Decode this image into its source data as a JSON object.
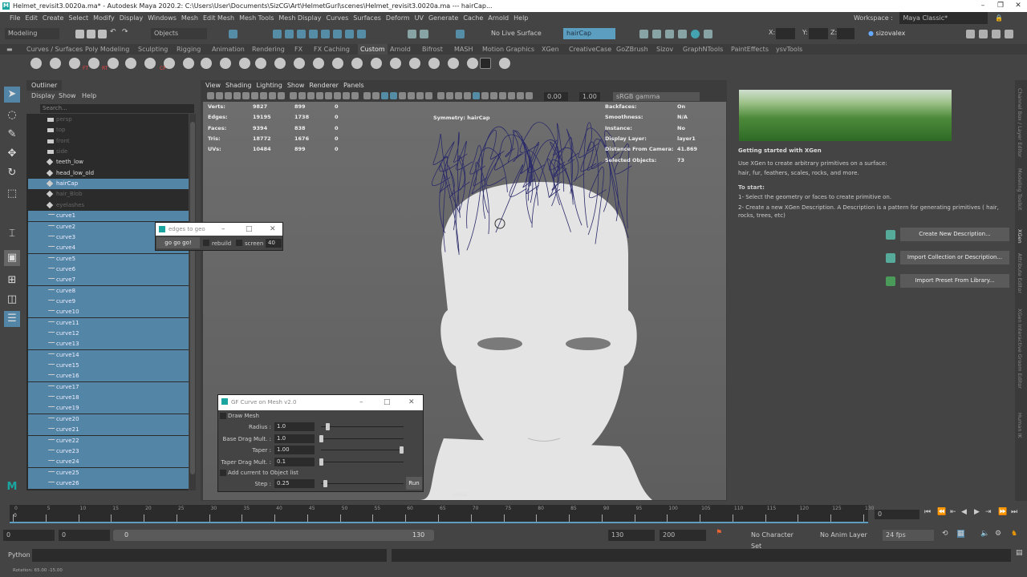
{
  "window": {
    "title": "Helmet_revisit3.0020a.ma* - Autodesk Maya 2020.2: C:\\Users\\User\\Documents\\SizCG\\Art\\HelmetGurl\\scenes\\Helmet_revisit3.0020a.ma  ---  hairCap...",
    "logo": "M"
  },
  "menubar": {
    "items": [
      "File",
      "Edit",
      "Create",
      "Select",
      "Modify",
      "Display",
      "Windows",
      "Mesh",
      "Edit Mesh",
      "Mesh Tools",
      "Mesh Display",
      "Curves",
      "Surfaces",
      "Deform",
      "UV",
      "Generate",
      "Cache",
      "Arnold",
      "Help"
    ],
    "workspace_label": "Workspace :",
    "workspace_value": "Maya Classic*"
  },
  "statusline": {
    "mode": "Modeling",
    "objects": "Objects",
    "live_surface": "No Live Surface",
    "selection_field": "hairCap",
    "x_label": "X:",
    "y_label": "Y:",
    "z_label": "Z:",
    "user": "sizovalex"
  },
  "shelf": {
    "tabs": [
      "Curves / Surfaces",
      "Poly Modeling",
      "Sculpting",
      "Rigging",
      "Animation",
      "Rendering",
      "FX",
      "FX Caching",
      "Custom",
      "Arnold",
      "Bifrost",
      "MASH",
      "Motion Graphics",
      "XGen",
      "CreativeCase",
      "GoZBrush",
      "Sizov",
      "GraphNTools",
      "PaintEffects",
      "ysvTools"
    ],
    "active": "Custom",
    "icon_labels": [
      "FT",
      "RT",
      "CP"
    ]
  },
  "outliner": {
    "tab": "Outliner",
    "menu": [
      "Display",
      "Show",
      "Help"
    ],
    "search_placeholder": "Search...",
    "items": [
      {
        "label": "persp",
        "type": "camera",
        "state": "dim"
      },
      {
        "label": "top",
        "type": "camera",
        "state": "dim"
      },
      {
        "label": "front",
        "type": "camera",
        "state": "dim"
      },
      {
        "label": "side",
        "type": "camera",
        "state": "dim"
      },
      {
        "label": "teeth_low",
        "type": "mesh",
        "state": ""
      },
      {
        "label": "head_low_old",
        "type": "mesh",
        "state": ""
      },
      {
        "label": "hairCap",
        "type": "mesh",
        "state": "sel"
      },
      {
        "label": "hair_Blob",
        "type": "mesh",
        "state": "dim"
      },
      {
        "label": "eyelashes",
        "type": "mesh",
        "state": "dim"
      },
      {
        "label": "curve1",
        "type": "curve",
        "state": "sel"
      },
      {
        "label": "curve2",
        "type": "curve",
        "state": "sel"
      },
      {
        "label": "curve3",
        "type": "curve",
        "state": "sel"
      },
      {
        "label": "curve4",
        "type": "curve",
        "state": "sel"
      },
      {
        "label": "curve5",
        "type": "curve",
        "state": "sel"
      },
      {
        "label": "curve6",
        "type": "curve",
        "state": "sel"
      },
      {
        "label": "curve7",
        "type": "curve",
        "state": "sel"
      },
      {
        "label": "curve8",
        "type": "curve",
        "state": "sel"
      },
      {
        "label": "curve9",
        "type": "curve",
        "state": "sel"
      },
      {
        "label": "curve10",
        "type": "curve",
        "state": "sel"
      },
      {
        "label": "curve11",
        "type": "curve",
        "state": "sel"
      },
      {
        "label": "curve12",
        "type": "curve",
        "state": "sel"
      },
      {
        "label": "curve13",
        "type": "curve",
        "state": "sel"
      },
      {
        "label": "curve14",
        "type": "curve",
        "state": "sel"
      },
      {
        "label": "curve15",
        "type": "curve",
        "state": "sel"
      },
      {
        "label": "curve16",
        "type": "curve",
        "state": "sel"
      },
      {
        "label": "curve17",
        "type": "curve",
        "state": "sel"
      },
      {
        "label": "curve18",
        "type": "curve",
        "state": "sel"
      },
      {
        "label": "curve19",
        "type": "curve",
        "state": "sel"
      },
      {
        "label": "curve20",
        "type": "curve",
        "state": "sel"
      },
      {
        "label": "curve21",
        "type": "curve",
        "state": "sel"
      },
      {
        "label": "curve22",
        "type": "curve",
        "state": "sel"
      },
      {
        "label": "curve23",
        "type": "curve",
        "state": "sel"
      },
      {
        "label": "curve24",
        "type": "curve",
        "state": "sel"
      },
      {
        "label": "curve25",
        "type": "curve",
        "state": "sel"
      },
      {
        "label": "curve26",
        "type": "curve",
        "state": "sel"
      }
    ]
  },
  "viewport": {
    "menu": [
      "View",
      "Shading",
      "Lighting",
      "Show",
      "Renderer",
      "Panels"
    ],
    "exposure": "0.00",
    "gamma": "1.00",
    "color_space": "sRGB gamma",
    "stats": [
      {
        "label": "Verts:",
        "a": "9827",
        "b": "899",
        "c": "0"
      },
      {
        "label": "Edges:",
        "a": "19195",
        "b": "1738",
        "c": "0"
      },
      {
        "label": "Faces:",
        "a": "9394",
        "b": "838",
        "c": "0"
      },
      {
        "label": "Tris:",
        "a": "18772",
        "b": "1676",
        "c": "0"
      },
      {
        "label": "UVs:",
        "a": "10484",
        "b": "899",
        "c": "0"
      }
    ],
    "symmetry": "Symmetry: hairCap",
    "info": [
      {
        "label": "Backfaces:",
        "value": "On"
      },
      {
        "label": "Smoothness:",
        "value": "N/A"
      },
      {
        "label": "Instance:",
        "value": "No"
      },
      {
        "label": "Display Layer:",
        "value": "layer1"
      },
      {
        "label": "Distance From Camera:",
        "value": "41.869"
      },
      {
        "label": "Selected Objects:",
        "value": "73"
      }
    ],
    "camera": "persp",
    "hair_color": "#2a2a6a"
  },
  "edges_dialog": {
    "title": "edges to geo",
    "button": "go go go!",
    "rebuild": "rebuild",
    "screen": "screen",
    "screen_value": "40"
  },
  "curve_dialog": {
    "title": "GF Curve on Mesh v2.0",
    "draw_mesh": "Draw Mesh",
    "fields": [
      {
        "label": "Radius :",
        "value": "1.0",
        "slider": 0.08
      },
      {
        "label": "Base Drag Mult. :",
        "value": "1.0",
        "slider": 0.0
      },
      {
        "label": "Taper :",
        "value": "1.00",
        "slider": 1.0
      },
      {
        "label": "Taper Drag Mult. :",
        "value": "0.1",
        "slider": 0.0
      }
    ],
    "add_current": "Add current to Object list",
    "step_label": "Step :",
    "step_value": "0.25",
    "step_slider": 0.05,
    "run": "Run"
  },
  "xgen": {
    "heading": "Getting started with XGen",
    "intro1": "Use XGen to create arbitrary primitives on a surface:",
    "intro2": "hair, fur, feathers, scales, rocks, and more.",
    "to_start": "To start:",
    "step1": "1- Select the geometry or faces to create primitive on.",
    "step2": "2- Create a new XGen Description. A Description is a pattern for generating primitives ( hair, rocks, trees, etc)",
    "buttons": [
      "Create New Description...",
      "Import Collection or Description...",
      "Import Preset From Library..."
    ]
  },
  "right_tabs": [
    "Channel Box / Layer Editor",
    "Modeling Toolkit",
    "XGen",
    "Attribute Editor",
    "XGen Interactive Groom Editor",
    "Human IK"
  ],
  "timeline": {
    "start": 0,
    "end": 130,
    "step": 5,
    "current": "0",
    "current_field": "0"
  },
  "range": {
    "start": "0",
    "playback_start": "0",
    "slider_start": "0",
    "slider_end": "130",
    "playback_end": "130",
    "end": "200",
    "character_set": "No Character Set",
    "anim_layer": "No Anim Layer",
    "fps": "24 fps"
  },
  "command": {
    "language": "Python"
  },
  "help_line": "Rotation:   65.00   -15.00"
}
